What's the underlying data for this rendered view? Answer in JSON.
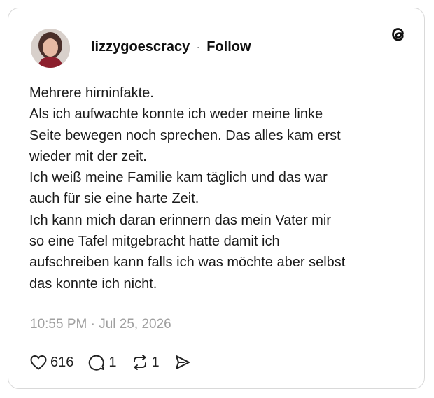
{
  "post": {
    "username": "lizzygoescracy",
    "separator": "·",
    "follow_label": "Follow",
    "lines": [
      "Mehrere hirninfakte.",
      "Als ich aufwachte konnte ich weder meine linke",
      "Seite bewegen noch sprechen. Das alles kam erst",
      "wieder mit der zeit.",
      "Ich weiß meine Familie kam täglich und das war",
      "auch für sie eine harte Zeit.",
      "Ich kann mich daran erinnern das mein Vater mir",
      "so eine Tafel mitgebracht hatte damit ich",
      "aufschreiben kann falls ich was möchte aber selbst",
      "das konnte ich nicht."
    ],
    "timestamp": "10:55 PM · Jul 25, 2026"
  },
  "actions": {
    "likes": "616",
    "replies": "1",
    "reposts": "1"
  },
  "icons": {
    "brand": "threads-logo-icon",
    "like": "heart-icon",
    "reply": "comment-icon",
    "repost": "repost-icon",
    "share": "send-icon"
  }
}
